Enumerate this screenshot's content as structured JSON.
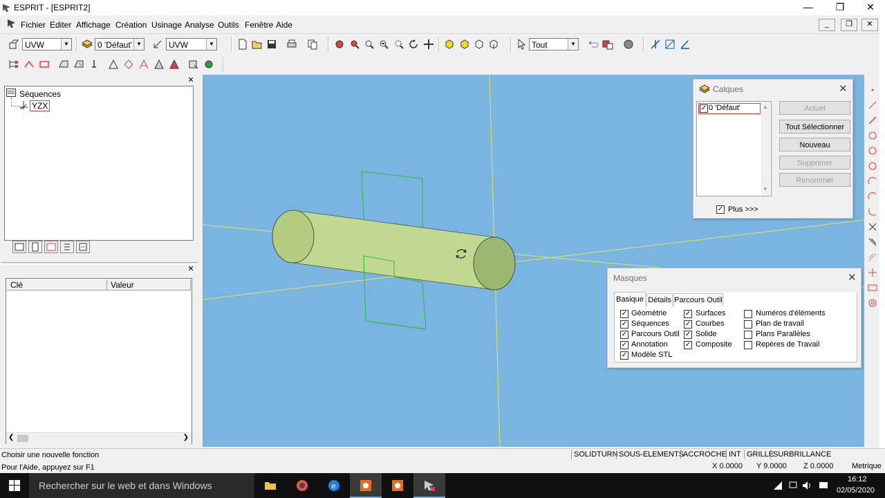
{
  "window": {
    "title": "ESPRIT - [ESPRIT2]"
  },
  "menu": [
    "Fichier",
    "Editer",
    "Affichage",
    "Création",
    "Usinage",
    "Analyse",
    "Outils",
    "Fenêtre",
    "Aide"
  ],
  "toolbar": {
    "combo_plane1": "UVW",
    "combo_layer": "0 'Défaut'",
    "combo_plane2": "UVW",
    "combo_filter": "Tout"
  },
  "tree": {
    "root": "Séquences",
    "child": "YZX"
  },
  "properties": {
    "col_key": "Clé",
    "col_value": "Valeur"
  },
  "calques": {
    "title": "Calques",
    "layer_item": "0 'Défaut'",
    "buttons": [
      "Actuel",
      "Tout Sélectionner",
      "Nouveau",
      "Supprimer",
      "Renommer"
    ],
    "plus": "Plus >>>"
  },
  "masques": {
    "title": "Masques",
    "tabs": [
      "Basique",
      "Détails",
      "Parcours Outil"
    ],
    "col1": [
      {
        "label": "Géométrie",
        "checked": true
      },
      {
        "label": "Séquences",
        "checked": true
      },
      {
        "label": "Parcours Outil",
        "checked": true
      },
      {
        "label": "Annotation",
        "checked": true
      },
      {
        "label": "Modèle STL",
        "checked": true
      }
    ],
    "col2": [
      {
        "label": "Surfaces",
        "checked": true
      },
      {
        "label": "Courbes",
        "checked": true
      },
      {
        "label": "Solide",
        "checked": true
      },
      {
        "label": "Composite",
        "checked": true
      }
    ],
    "col3": [
      {
        "label": "Numéros d'éléments",
        "checked": false
      },
      {
        "label": "Plan de travail",
        "checked": false
      },
      {
        "label": "Plans Parallèles",
        "checked": false
      },
      {
        "label": "Repères de Travail",
        "checked": false
      }
    ]
  },
  "status": {
    "line1": "Choisir une nouvelle fonction",
    "line2": "Pour l'Aide, appuyez sur F1",
    "panels": [
      "SOLIDTURN",
      "SOUS-ELEMENTS",
      "ACCROCHE",
      "INT",
      "GRILLE",
      "SURBRILLANCE"
    ],
    "coord_x": "X 0.0000",
    "coord_y": "Y 9.0000",
    "coord_z": "Z 0.0000",
    "units": "Metrique"
  },
  "taskbar": {
    "search_placeholder": "Rechercher sur le web et dans Windows",
    "time": "16:12",
    "date": "02/05/2020"
  },
  "colors": {
    "viewport": "#7ab4e0",
    "axis": "#e8e84a",
    "plane": "#22c02a",
    "cylinder": "#c0d890"
  }
}
